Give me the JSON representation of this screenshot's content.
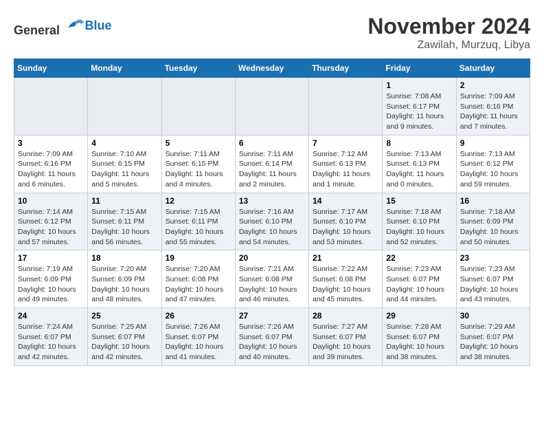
{
  "header": {
    "logo_general": "General",
    "logo_blue": "Blue",
    "month": "November 2024",
    "location": "Zawilah, Murzuq, Libya"
  },
  "weekdays": [
    "Sunday",
    "Monday",
    "Tuesday",
    "Wednesday",
    "Thursday",
    "Friday",
    "Saturday"
  ],
  "weeks": [
    [
      {
        "day": "",
        "empty": true
      },
      {
        "day": "",
        "empty": true
      },
      {
        "day": "",
        "empty": true
      },
      {
        "day": "",
        "empty": true
      },
      {
        "day": "",
        "empty": true
      },
      {
        "day": "1",
        "sunrise": "7:08 AM",
        "sunset": "6:17 PM",
        "daylight": "11 hours and 9 minutes."
      },
      {
        "day": "2",
        "sunrise": "7:09 AM",
        "sunset": "6:16 PM",
        "daylight": "11 hours and 7 minutes."
      }
    ],
    [
      {
        "day": "3",
        "sunrise": "7:09 AM",
        "sunset": "6:16 PM",
        "daylight": "11 hours and 6 minutes."
      },
      {
        "day": "4",
        "sunrise": "7:10 AM",
        "sunset": "6:15 PM",
        "daylight": "11 hours and 5 minutes."
      },
      {
        "day": "5",
        "sunrise": "7:11 AM",
        "sunset": "6:15 PM",
        "daylight": "11 hours and 4 minutes."
      },
      {
        "day": "6",
        "sunrise": "7:11 AM",
        "sunset": "6:14 PM",
        "daylight": "11 hours and 2 minutes."
      },
      {
        "day": "7",
        "sunrise": "7:12 AM",
        "sunset": "6:13 PM",
        "daylight": "11 hours and 1 minute."
      },
      {
        "day": "8",
        "sunrise": "7:13 AM",
        "sunset": "6:13 PM",
        "daylight": "11 hours and 0 minutes."
      },
      {
        "day": "9",
        "sunrise": "7:13 AM",
        "sunset": "6:12 PM",
        "daylight": "10 hours and 59 minutes."
      }
    ],
    [
      {
        "day": "10",
        "sunrise": "7:14 AM",
        "sunset": "6:12 PM",
        "daylight": "10 hours and 57 minutes."
      },
      {
        "day": "11",
        "sunrise": "7:15 AM",
        "sunset": "6:11 PM",
        "daylight": "10 hours and 56 minutes."
      },
      {
        "day": "12",
        "sunrise": "7:15 AM",
        "sunset": "6:11 PM",
        "daylight": "10 hours and 55 minutes."
      },
      {
        "day": "13",
        "sunrise": "7:16 AM",
        "sunset": "6:10 PM",
        "daylight": "10 hours and 54 minutes."
      },
      {
        "day": "14",
        "sunrise": "7:17 AM",
        "sunset": "6:10 PM",
        "daylight": "10 hours and 53 minutes."
      },
      {
        "day": "15",
        "sunrise": "7:18 AM",
        "sunset": "6:10 PM",
        "daylight": "10 hours and 52 minutes."
      },
      {
        "day": "16",
        "sunrise": "7:18 AM",
        "sunset": "6:09 PM",
        "daylight": "10 hours and 50 minutes."
      }
    ],
    [
      {
        "day": "17",
        "sunrise": "7:19 AM",
        "sunset": "6:09 PM",
        "daylight": "10 hours and 49 minutes."
      },
      {
        "day": "18",
        "sunrise": "7:20 AM",
        "sunset": "6:09 PM",
        "daylight": "10 hours and 48 minutes."
      },
      {
        "day": "19",
        "sunrise": "7:20 AM",
        "sunset": "6:08 PM",
        "daylight": "10 hours and 47 minutes."
      },
      {
        "day": "20",
        "sunrise": "7:21 AM",
        "sunset": "6:08 PM",
        "daylight": "10 hours and 46 minutes."
      },
      {
        "day": "21",
        "sunrise": "7:22 AM",
        "sunset": "6:08 PM",
        "daylight": "10 hours and 45 minutes."
      },
      {
        "day": "22",
        "sunrise": "7:23 AM",
        "sunset": "6:07 PM",
        "daylight": "10 hours and 44 minutes."
      },
      {
        "day": "23",
        "sunrise": "7:23 AM",
        "sunset": "6:07 PM",
        "daylight": "10 hours and 43 minutes."
      }
    ],
    [
      {
        "day": "24",
        "sunrise": "7:24 AM",
        "sunset": "6:07 PM",
        "daylight": "10 hours and 42 minutes."
      },
      {
        "day": "25",
        "sunrise": "7:25 AM",
        "sunset": "6:07 PM",
        "daylight": "10 hours and 42 minutes."
      },
      {
        "day": "26",
        "sunrise": "7:26 AM",
        "sunset": "6:07 PM",
        "daylight": "10 hours and 41 minutes."
      },
      {
        "day": "27",
        "sunrise": "7:26 AM",
        "sunset": "6:07 PM",
        "daylight": "10 hours and 40 minutes."
      },
      {
        "day": "28",
        "sunrise": "7:27 AM",
        "sunset": "6:07 PM",
        "daylight": "10 hours and 39 minutes."
      },
      {
        "day": "29",
        "sunrise": "7:28 AM",
        "sunset": "6:07 PM",
        "daylight": "10 hours and 38 minutes."
      },
      {
        "day": "30",
        "sunrise": "7:29 AM",
        "sunset": "6:07 PM",
        "daylight": "10 hours and 38 minutes."
      }
    ]
  ]
}
